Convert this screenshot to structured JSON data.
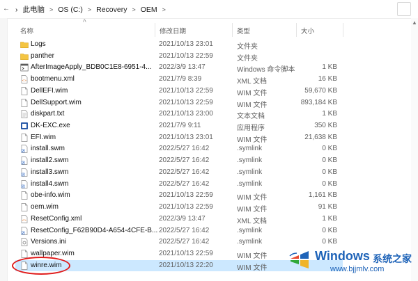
{
  "address_bar": {
    "nav_icon": "back-arrow",
    "crumbs": [
      "此电脑",
      "OS (C:)",
      "Recovery",
      "OEM"
    ],
    "separator": ">"
  },
  "columns": {
    "name": "名称",
    "date": "修改日期",
    "type": "类型",
    "size": "大小"
  },
  "files": [
    {
      "name": "Logs",
      "date": "2021/10/13 23:01",
      "type": "文件夹",
      "size": "",
      "icon": "folder-icon"
    },
    {
      "name": "panther",
      "date": "2021/10/13 22:59",
      "type": "文件夹",
      "size": "",
      "icon": "folder-icon"
    },
    {
      "name": "AfterImageApply_BDB0C1E8-6951-4...",
      "date": "2022/3/9 13:47",
      "type": "Windows 命令脚本",
      "size": "1 KB",
      "icon": "script-icon"
    },
    {
      "name": "bootmenu.xml",
      "date": "2021/7/9 8:39",
      "type": "XML 文档",
      "size": "16 KB",
      "icon": "xml-icon"
    },
    {
      "name": "DellEFI.wim",
      "date": "2021/10/13 22:59",
      "type": "WIM 文件",
      "size": "59,670 KB",
      "icon": "file-icon"
    },
    {
      "name": "DellSupport.wim",
      "date": "2021/10/13 22:59",
      "type": "WIM 文件",
      "size": "893,184 KB",
      "icon": "file-icon"
    },
    {
      "name": "diskpart.txt",
      "date": "2021/10/13 23:00",
      "type": "文本文档",
      "size": "1 KB",
      "icon": "text-icon"
    },
    {
      "name": "DK-EXC.exe",
      "date": "2021/7/9 9:11",
      "type": "应用程序",
      "size": "350 KB",
      "icon": "exe-icon"
    },
    {
      "name": "EFI.wim",
      "date": "2021/10/13 23:01",
      "type": "WIM 文件",
      "size": "21,638 KB",
      "icon": "file-icon"
    },
    {
      "name": "install.swm",
      "date": "2022/5/27 16:42",
      "type": ".symlink",
      "size": "0 KB",
      "icon": "symlink-icon"
    },
    {
      "name": "install2.swm",
      "date": "2022/5/27 16:42",
      "type": ".symlink",
      "size": "0 KB",
      "icon": "symlink-icon"
    },
    {
      "name": "install3.swm",
      "date": "2022/5/27 16:42",
      "type": ".symlink",
      "size": "0 KB",
      "icon": "symlink-icon"
    },
    {
      "name": "install4.swm",
      "date": "2022/5/27 16:42",
      "type": ".symlink",
      "size": "0 KB",
      "icon": "symlink-icon"
    },
    {
      "name": "obe-info.wim",
      "date": "2021/10/13 22:59",
      "type": "WIM 文件",
      "size": "1,161 KB",
      "icon": "file-icon"
    },
    {
      "name": "oem.wim",
      "date": "2021/10/13 22:59",
      "type": "WIM 文件",
      "size": "91 KB",
      "icon": "file-icon"
    },
    {
      "name": "ResetConfig.xml",
      "date": "2022/3/9 13:47",
      "type": "XML 文档",
      "size": "1 KB",
      "icon": "xml-icon"
    },
    {
      "name": "ResetConfig_F62B90D4-A654-4CFE-B...",
      "date": "2022/5/27 16:42",
      "type": ".symlink",
      "size": "0 KB",
      "icon": "symlink-icon"
    },
    {
      "name": "Versions.ini",
      "date": "2022/5/27 16:42",
      "type": ".symlink",
      "size": "0 KB",
      "icon": "ini-icon"
    },
    {
      "name": "wallpaper.wim",
      "date": "2021/10/13 22:59",
      "type": "WIM 文件",
      "size": "",
      "icon": "file-icon"
    },
    {
      "name": "winre.wim",
      "date": "2021/10/13 22:20",
      "type": "WIM 文件",
      "size": "",
      "icon": "file-icon",
      "selected": true
    }
  ],
  "watermark": {
    "title": "Windows",
    "cn": "系统之家",
    "url": "www.bjjmlv.com"
  },
  "colors": {
    "selected_row": "#cce8ff",
    "highlight_ellipse": "#e01b1b",
    "folder": "#f4c542",
    "watermark": "#1e63b8"
  }
}
